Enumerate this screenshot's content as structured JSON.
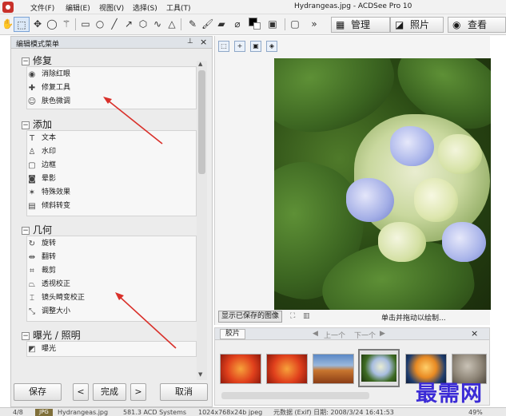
{
  "window": {
    "title": "Hydrangeas.jpg - ACDSee Pro 10",
    "menu": [
      "文件(F)",
      "编辑(E)",
      "视图(V)",
      "选择(S)",
      "工具(T)"
    ]
  },
  "mode_buttons": [
    {
      "label": "管理",
      "icon": "grid-icon"
    },
    {
      "label": "照片",
      "icon": "photo-icon"
    },
    {
      "label": "查看",
      "icon": "eye-icon"
    }
  ],
  "panel": {
    "title": "编辑模式菜单",
    "groups": [
      {
        "title": "修复",
        "items": [
          {
            "label": "消除红眼",
            "icon": "eye-icon"
          },
          {
            "label": "修复工具",
            "icon": "bandage-icon"
          },
          {
            "label": "肤色微调",
            "icon": "person-icon"
          }
        ]
      },
      {
        "title": "添加",
        "items": [
          {
            "label": "文本",
            "icon": "text-icon"
          },
          {
            "label": "水印",
            "icon": "stamp-icon"
          },
          {
            "label": "边框",
            "icon": "frame-icon"
          },
          {
            "label": "晕影",
            "icon": "vignette-icon"
          },
          {
            "label": "特殊效果",
            "icon": "magic-icon"
          },
          {
            "label": "倾斜转变",
            "icon": "tilt-icon"
          }
        ]
      },
      {
        "title": "几何",
        "items": [
          {
            "label": "旋转",
            "icon": "rotate-icon"
          },
          {
            "label": "翻转",
            "icon": "flip-icon"
          },
          {
            "label": "裁剪",
            "icon": "crop-icon"
          },
          {
            "label": "透视校正",
            "icon": "perspective-icon"
          },
          {
            "label": "镜头畸变校正",
            "icon": "lens-icon"
          },
          {
            "label": "调整大小",
            "icon": "resize-icon"
          }
        ]
      },
      {
        "title": "曝光 / 照明",
        "items": [
          {
            "label": "曝光",
            "icon": "exposure-icon"
          }
        ]
      }
    ],
    "buttons": {
      "save": "保存",
      "prev": "<",
      "done": "完成",
      "next": ">",
      "cancel": "取消"
    }
  },
  "viewer": {
    "show_saved": "显示已保存的图像",
    "hint": "单击并拖动以绘制..."
  },
  "filmstrip": {
    "tab": "胶片",
    "prev": "上一个",
    "next": "下一个",
    "thumbnails": [
      "red-flower",
      "red-flower",
      "desert",
      "hydrangea",
      "jellyfish",
      "koala"
    ],
    "selected_index": 3
  },
  "statusbar": {
    "index": "4/8",
    "format": "JPG",
    "filename": "Hydrangeas.jpg",
    "size": "581.3 ACD Systems",
    "dims": "1024x768x24b jpeg",
    "date": "元数据 (Exif) 日期: 2008/3/24 16:41:53",
    "zoom": "49%"
  },
  "watermark": "最需网",
  "colors": {
    "accent": "#d9302a",
    "watermark": "#3b2bd6"
  }
}
